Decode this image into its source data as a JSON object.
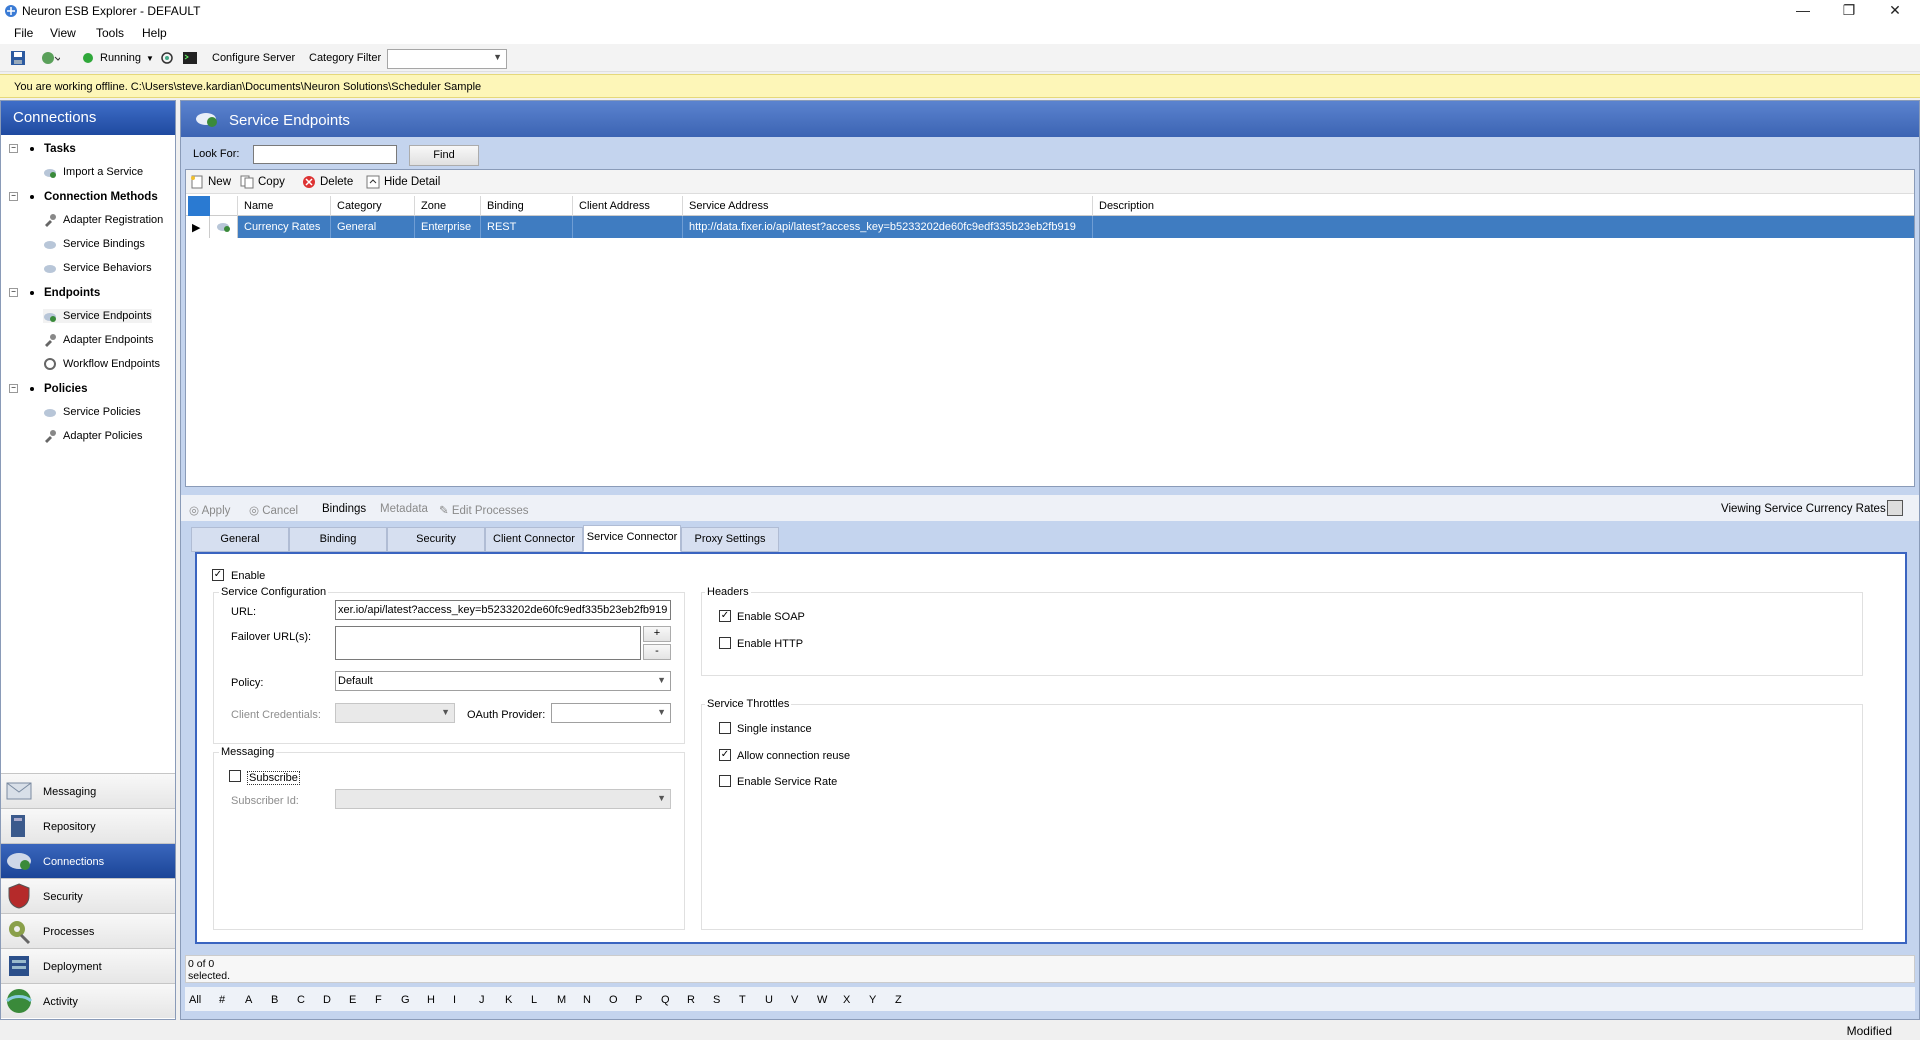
{
  "window": {
    "title": "Neuron ESB Explorer - DEFAULT",
    "min_glyph": "—",
    "restore_glyph": "❐",
    "close_glyph": "✕"
  },
  "menu": [
    "File",
    "View",
    "Tools",
    "Help"
  ],
  "toolbar": {
    "status_label": "Running",
    "configure_server": "Configure Server",
    "category_filter_label": "Category Filter",
    "category_filter_value": ""
  },
  "banner": {
    "text": "You are working offline. C:\\Users\\steve.kardian\\Documents\\Neuron Solutions\\Scheduler Sample"
  },
  "left_panel": {
    "title": "Connections",
    "groups": [
      {
        "label": "Tasks",
        "items": [
          "Import a Service"
        ]
      },
      {
        "label": "Connection Methods",
        "items": [
          "Adapter Registration",
          "Service Bindings",
          "Service Behaviors"
        ]
      },
      {
        "label": "Endpoints",
        "items": [
          "Service Endpoints",
          "Adapter Endpoints",
          "Workflow Endpoints"
        ]
      },
      {
        "label": "Policies",
        "items": [
          "Service Policies",
          "Adapter Policies"
        ]
      }
    ],
    "nav": [
      "Messaging",
      "Repository",
      "Connections",
      "Security",
      "Processes",
      "Deployment",
      "Activity"
    ]
  },
  "main": {
    "title": "Service Endpoints",
    "look_for_label": "Look For:",
    "look_for_value": "",
    "find_button": "Find",
    "grid_tools": {
      "new": "New",
      "copy": "Copy",
      "delete": "Delete",
      "hide_detail": "Hide Detail"
    },
    "columns": [
      "Name",
      "Category",
      "Zone",
      "Binding",
      "Client Address",
      "Service Address",
      "Description"
    ],
    "row": {
      "name": "Currency Rates",
      "category": "General",
      "zone": "Enterprise",
      "binding": "REST",
      "client_address": "",
      "service_address": "http://data.fixer.io/api/latest?access_key=b5233202de60fc9edf335b23eb2fb919",
      "description": ""
    },
    "detail_tools": {
      "apply": "Apply",
      "cancel": "Cancel",
      "bindings": "Bindings",
      "metadata": "Metadata",
      "edit_processes": "Edit Processes",
      "viewing": "Viewing Service Currency Rates"
    },
    "tabs": [
      "General",
      "Binding",
      "Security",
      "Client Connector",
      "Service Connector",
      "Proxy Settings"
    ],
    "service_connector": {
      "enable_label": "Enable",
      "enable_checked": true,
      "service_config_title": "Service Configuration",
      "url_label": "URL:",
      "url_value": "xer.io/api/latest?access_key=b5233202de60fc9edf335b23eb2fb919",
      "failover_label": "Failover URL(s):",
      "plus": "+",
      "minus": "-",
      "policy_label": "Policy:",
      "policy_value": "Default",
      "client_credentials_label": "Client Credentials:",
      "oauth_label": "OAuth Provider:",
      "messaging_title": "Messaging",
      "subscribe_label": "Subscribe",
      "subscriber_id_label": "Subscriber Id:",
      "headers_title": "Headers",
      "enable_soap": "Enable SOAP",
      "enable_http": "Enable HTTP",
      "throttles_title": "Service Throttles",
      "single_instance": "Single instance",
      "allow_connection_reuse": "Allow connection reuse",
      "enable_service_rate": "Enable Service Rate"
    },
    "status_line1": "0 of 0",
    "status_line2": "selected.",
    "alpha": [
      "All",
      "#",
      "A",
      "B",
      "C",
      "D",
      "E",
      "F",
      "G",
      "H",
      "I",
      "J",
      "K",
      "L",
      "M",
      "N",
      "O",
      "P",
      "Q",
      "R",
      "S",
      "T",
      "U",
      "V",
      "W",
      "X",
      "Y",
      "Z"
    ]
  },
  "statusbar": {
    "text": "Modified"
  },
  "colors": {
    "accent": "#3f7cc1",
    "header": "#1f4aa0",
    "banner": "#fdf6b8"
  }
}
